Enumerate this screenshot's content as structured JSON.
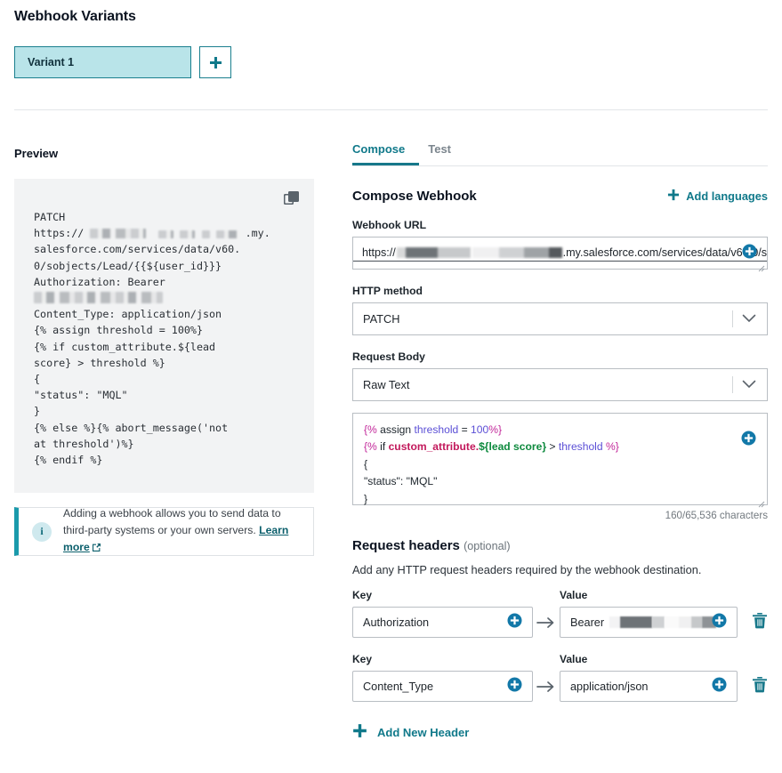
{
  "variants": {
    "title": "Webhook Variants",
    "tabs": [
      {
        "label": "Variant 1"
      }
    ],
    "add_variant_icon": "plus-icon"
  },
  "preview": {
    "label": "Preview",
    "copy_icon": "copy-icon",
    "code_lines": [
      "PATCH",
      "https:// [redacted] .my.salesforce.com/services/data/v60.0/sobjects/Lead/{{${user_id}}}",
      "Authorization: Bearer [redacted]",
      "Content_Type: application/json",
      "{% assign threshold = 100%}",
      "{% if custom_attribute.${lead score} > threshold %}",
      "{",
      "\"status\": \"MQL\"",
      "}",
      "{% else %}{% abort_message('not at threshold')%}",
      "{% endif %}"
    ],
    "code_part_1": "PATCH\nhttps:// ",
    "code_part_2": " .my.\nsalesforce.com/services/data/v60.\n0/sobjects/Lead/{{${user_id}}}\nAuthorization: Bearer\n",
    "code_part_3": "\nContent_Type: application/json\n{% assign threshold = 100%}\n{% if custom_attribute.${lead\nscore} > threshold %}\n{\n\"status\": \"MQL\"\n}\n{% else %}{% abort_message('not\nat threshold')%}\n{% endif %}"
  },
  "info": {
    "icon": "info-icon",
    "text": "Adding a webhook allows you to send data to third-party systems or your own servers.",
    "link_label": "Learn more",
    "link_icon": "external-link-icon"
  },
  "tabs": {
    "items": [
      {
        "label": "Compose",
        "active": true
      },
      {
        "label": "Test",
        "active": false
      }
    ]
  },
  "compose": {
    "title": "Compose Webhook",
    "add_languages_label": "Add languages",
    "add_languages_icon": "plus-icon",
    "webhook_url_label": "Webhook URL",
    "webhook_url_value_prefix": "https://",
    "webhook_url_value_suffix": ".my.salesforce.com/services/data/v60.0/s",
    "webhook_url_personalize_icon": "circle-plus-icon",
    "http_method_label": "HTTP method",
    "http_method_value": "PATCH",
    "request_body_label": "Request Body",
    "request_body_value": "Raw Text",
    "editor_personalize_icon": "circle-plus-icon",
    "editor": {
      "line1": {
        "d1": "{%",
        "kw": " assign ",
        "var": "threshold",
        "op": " = ",
        "num": "100",
        "d2": "%}"
      },
      "line2": {
        "d1": "{%",
        "kw": " if ",
        "attr": "custom_attribute",
        "dot": ".",
        "green": "${lead score}",
        "gt": " > ",
        "var": "threshold",
        "d2": " %}"
      },
      "line3": "{",
      "line4": "\"status\": \"MQL\"",
      "line5": "}"
    },
    "char_count": "160/65,536 characters"
  },
  "request_headers": {
    "title": "Request headers",
    "optional_suffix": "(optional)",
    "description": "Add any HTTP request headers required by the webhook destination.",
    "key_label": "Key",
    "value_label": "Value",
    "rows": [
      {
        "key": "Authorization",
        "value": "Bearer",
        "value_redacted": true,
        "key_personalize_icon": "circle-plus-icon",
        "value_personalize_icon": "circle-plus-icon",
        "delete_icon": "trash-icon",
        "arrow_icon": "arrow-right-icon"
      },
      {
        "key": "Content_Type",
        "value": "application/json",
        "value_redacted": false,
        "key_personalize_icon": "circle-plus-icon",
        "value_personalize_icon": "circle-plus-icon",
        "delete_icon": "trash-icon",
        "arrow_icon": "arrow-right-icon"
      }
    ],
    "add_new_header_label": "Add New Header",
    "add_new_header_icon": "plus-icon"
  },
  "colors": {
    "teal": "#10798a",
    "teal_dark": "#0b5f6c",
    "variant_fill": "#b9e4e9",
    "preview_bg": "#f2f3f4",
    "border": "#b9bec3",
    "token_delim": "#c2289a",
    "token_var": "#5b4fd6",
    "token_attr": "#c2185b",
    "token_green": "#0e8a3e"
  }
}
